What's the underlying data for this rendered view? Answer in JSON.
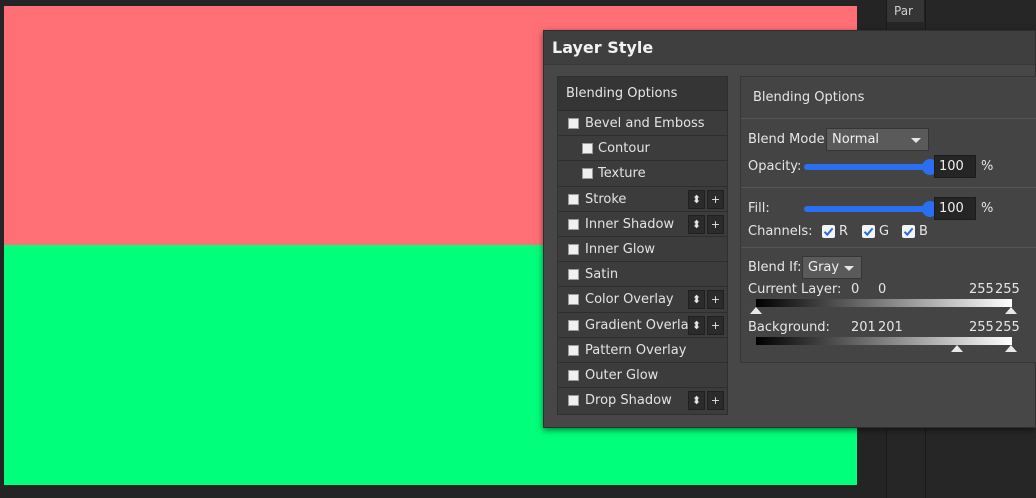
{
  "colors": {
    "canvas_top": "#ff6f75",
    "canvas_bottom": "#00ff7a",
    "accent": "#2a6ff2"
  },
  "right_panel": {
    "tab_label": "Par"
  },
  "dialog": {
    "title": "Layer Style",
    "effects": {
      "header": "Blending Options",
      "items": [
        {
          "label": "Bevel and Emboss"
        },
        {
          "label": "Contour"
        },
        {
          "label": "Texture"
        },
        {
          "label": "Stroke",
          "stack_icon": "⬍",
          "add": "+"
        },
        {
          "label": "Inner Shadow",
          "stack_icon": "⬍",
          "add": "+"
        },
        {
          "label": "Inner Glow"
        },
        {
          "label": "Satin"
        },
        {
          "label": "Color Overlay",
          "stack_icon": "⬍",
          "add": "+"
        },
        {
          "label": "Gradient Overlay",
          "stack_icon": "⬍",
          "add": "+"
        },
        {
          "label": "Pattern Overlay"
        },
        {
          "label": "Outer Glow"
        },
        {
          "label": "Drop Shadow",
          "stack_icon": "⬍",
          "add": "+"
        }
      ]
    },
    "options": {
      "header": "Blending Options",
      "blend_mode_label": "Blend Mode:",
      "blend_mode_value": "Normal",
      "opacity_label": "Opacity:",
      "opacity_value": "100",
      "opacity_unit": "%",
      "opacity_level": 1.0,
      "fill_label": "Fill:",
      "fill_value": "100",
      "fill_unit": "%",
      "fill_level": 1.0,
      "channels_label": "Channels:",
      "channels": [
        {
          "label": "R",
          "checked": true
        },
        {
          "label": "G",
          "checked": true
        },
        {
          "label": "B",
          "checked": true
        }
      ],
      "blend_if_label": "Blend If:",
      "blend_if_value": "Gray",
      "current_layer_label": "Current Layer:",
      "current_layer_low_a": "0",
      "current_layer_low_b": "0",
      "current_layer_high_a": "255",
      "current_layer_high_b": "255",
      "background_label": "Background:",
      "background_low_a": "201",
      "background_low_b": "201",
      "background_high_a": "255",
      "background_high_b": "255"
    }
  }
}
